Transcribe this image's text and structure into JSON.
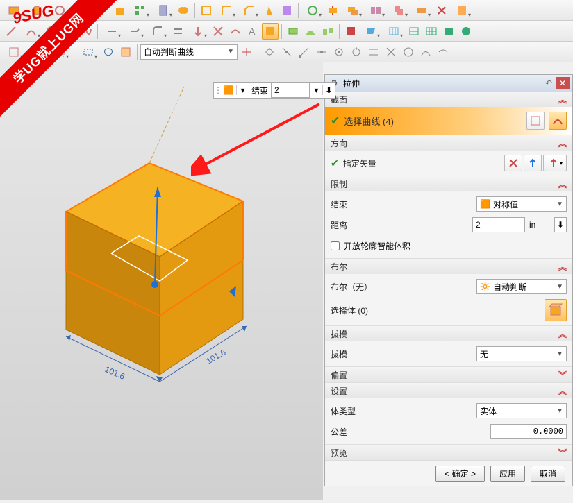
{
  "watermark": {
    "band": "学UG就上UG网",
    "corner": "9SUG"
  },
  "toolbar": {
    "curve_filter": "自动判断曲线"
  },
  "end_control": {
    "label": "结束",
    "value": "2"
  },
  "panel": {
    "title": "拉伸",
    "section_section": "截面",
    "select_curve": "选择曲线 (4)",
    "direction": "方向",
    "specify_vector": "指定矢量",
    "limits": "限制",
    "end_label": "结束",
    "end_option": "对称值",
    "distance": "距离",
    "distance_value": "2",
    "distance_unit": "in",
    "open_profile": "开放轮廓智能体积",
    "boolean": "布尔",
    "boolean_none": "布尔（无）",
    "boolean_option": "自动判断",
    "select_body": "选择体 (0)",
    "draft": "拔模",
    "draft_label": "拔模",
    "draft_option": "无",
    "offset": "偏置",
    "settings": "设置",
    "body_type": "体类型",
    "body_type_option": "实体",
    "tolerance": "公差",
    "tolerance_value": "0.0000",
    "preview": "预览",
    "ok": "< 确定 >",
    "apply": "应用",
    "cancel": "取消"
  },
  "viewport": {
    "dim1": "101.6",
    "dim2": "101.6"
  }
}
